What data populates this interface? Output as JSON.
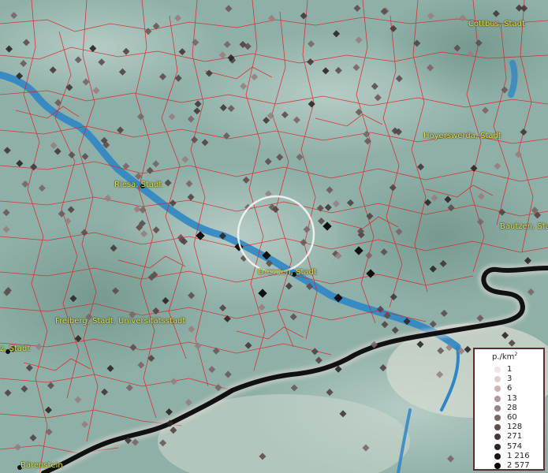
{
  "map": {
    "cities": [
      {
        "name": "Cottbus, Stadt",
        "dot": false
      },
      {
        "name": "Hoyerswerda, Stadt",
        "dot": false
      },
      {
        "name": "Riesa, Stadt",
        "dot": true
      },
      {
        "name": "Bautzen, Stadt",
        "dot": false
      },
      {
        "name": "Dresden, Stadt",
        "dot": true
      },
      {
        "name": "Freiberg, Stadt, Universitätsstadt",
        "dot": false
      },
      {
        "name": "z, Stadt",
        "dot": true
      },
      {
        "name": "Bärenstein",
        "dot": true
      }
    ],
    "colors": {
      "border_lines": "#e02020",
      "river": "#2f86c4",
      "land": "#8fb0a8",
      "label": "#e6e04a",
      "national_border": "#111111"
    }
  },
  "legend": {
    "unit_base": "p./km",
    "unit_sup": "2",
    "entries": [
      {
        "label": "1",
        "color": "#f0e6e6"
      },
      {
        "label": "3",
        "color": "#e0d0d0"
      },
      {
        "label": "6",
        "color": "#c8b4b4"
      },
      {
        "label": "13",
        "color": "#ae9898"
      },
      {
        "label": "28",
        "color": "#968080"
      },
      {
        "label": "60",
        "color": "#7a6666"
      },
      {
        "label": "128",
        "color": "#5e4e4e"
      },
      {
        "label": "271",
        "color": "#443838"
      },
      {
        "label": "574",
        "color": "#2e2626"
      },
      {
        "label": "1 216",
        "color": "#1a1414"
      },
      {
        "label": "2 577",
        "color": "#080606"
      }
    ]
  }
}
